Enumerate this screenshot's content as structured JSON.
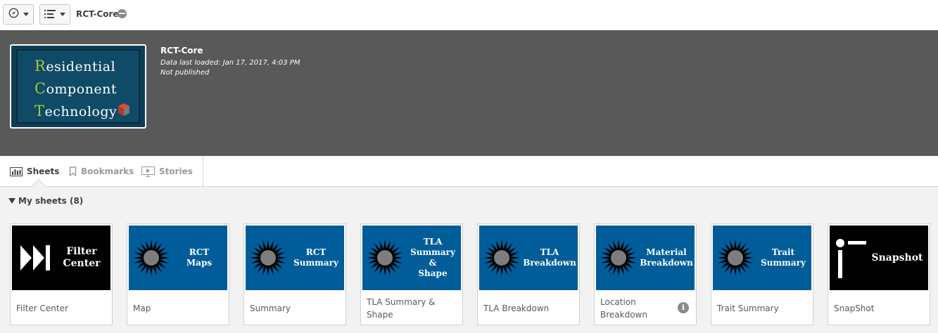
{
  "toolbar": {
    "nav_icon": "compass-icon",
    "list_icon": "list-icon",
    "app_title": "RCT-Core",
    "publish_icon": "globe-icon"
  },
  "header": {
    "app_name": "RCT-Core",
    "data_loaded": "Data last loaded: Jan 17, 2017, 4:03 PM",
    "publish_status": "Not published",
    "thumbnail": {
      "line1_cap": "R",
      "line1_rest": "esidential",
      "line2_cap": "C",
      "line2_rest": "omponent",
      "line3_cap": "T",
      "line3_rest": "echnology"
    }
  },
  "tabs": [
    {
      "label": "Sheets",
      "icon": "bar-chart-icon",
      "active": true
    },
    {
      "label": "Bookmarks",
      "icon": "bookmark-icon",
      "active": false
    },
    {
      "label": "Stories",
      "icon": "play-icon",
      "active": false
    }
  ],
  "section": {
    "title": "My sheets (8)"
  },
  "sheets": [
    {
      "label": "Filter Center",
      "thumb_text": "Filter\nCenter",
      "style": "black",
      "icon": "fast-forward-icon"
    },
    {
      "label": "Map",
      "thumb_text": "RCT\nMaps",
      "style": "blue",
      "icon": "burst-icon"
    },
    {
      "label": "Summary",
      "thumb_text": "RCT\nSummary",
      "style": "blue",
      "icon": "burst-icon"
    },
    {
      "label": "TLA Summary & Shape",
      "thumb_text": "TLA\nSummary\n&\nShape",
      "style": "blue",
      "icon": "burst-icon"
    },
    {
      "label": "TLA Breakdown",
      "thumb_text": "TLA\nBreakdown",
      "style": "blue",
      "icon": "burst-icon"
    },
    {
      "label": "Location Breakdown",
      "thumb_text": "Material\nBreakdown",
      "style": "blue",
      "icon": "burst-icon",
      "info": "i"
    },
    {
      "label": "Trait Summary",
      "thumb_text": "Trait\nSummary",
      "style": "blue",
      "icon": "burst-icon"
    },
    {
      "label": "SnapShot",
      "thumb_text": "Snapshot",
      "style": "black",
      "icon": "i-icon"
    }
  ],
  "colors": {
    "header_bg": "#595959",
    "thumb_blue": "#005d9a",
    "accent_green": "#a3c83a"
  }
}
